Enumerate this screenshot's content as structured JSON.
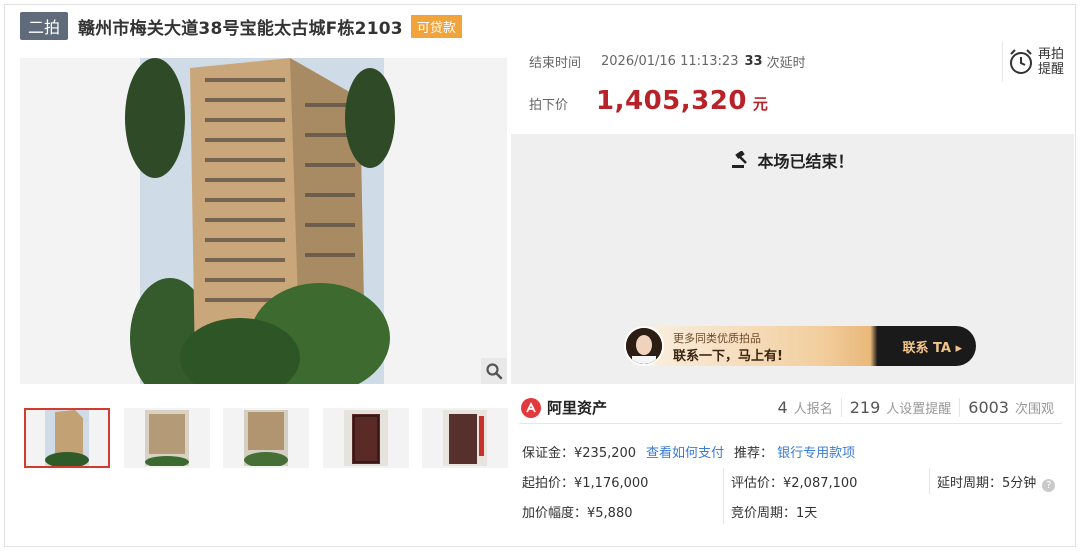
{
  "header": {
    "round_badge": "二拍",
    "title": "赣州市梅关大道38号宝能太古城F栋2103",
    "loan_badge": "可贷款"
  },
  "auction": {
    "end_label": "结束时间",
    "end_time": "2026/01/16 11:13:23",
    "extend_count": "33",
    "extend_suffix": "次延时",
    "price_label": "拍下价",
    "final_price": "1,405,320",
    "price_unit": "元",
    "remind_label_1": "再拍",
    "remind_label_2": "提醒",
    "status": "本场已结束！"
  },
  "promo": {
    "line1": "更多同类优质拍品",
    "line2": "联系一下，马上有!",
    "cta": "联系 TA ▸"
  },
  "platform": {
    "name": "阿里资产",
    "signups": "4",
    "signups_label": "人报名",
    "reminders": "219",
    "reminders_label": "人设置提醒",
    "views": "6003",
    "views_label": "次围观"
  },
  "details": {
    "deposit": "保证金：¥235,200",
    "how_to_pay": "查看如何支付",
    "recommend_label": "推荐：",
    "recommend_link": "银行专用款项",
    "start_price": "起拍价：¥1,176,000",
    "appraisal": "评估价：¥2,087,100",
    "delay_period": "延时周期：5分钟",
    "increment": "加价幅度：¥5,880",
    "bid_period": "竞价周期：1天"
  },
  "colors": {
    "price_red": "#b8232a",
    "link_blue": "#3a7bd5",
    "badge_orange": "#f1a33c",
    "thumb_active": "#d23c30"
  }
}
